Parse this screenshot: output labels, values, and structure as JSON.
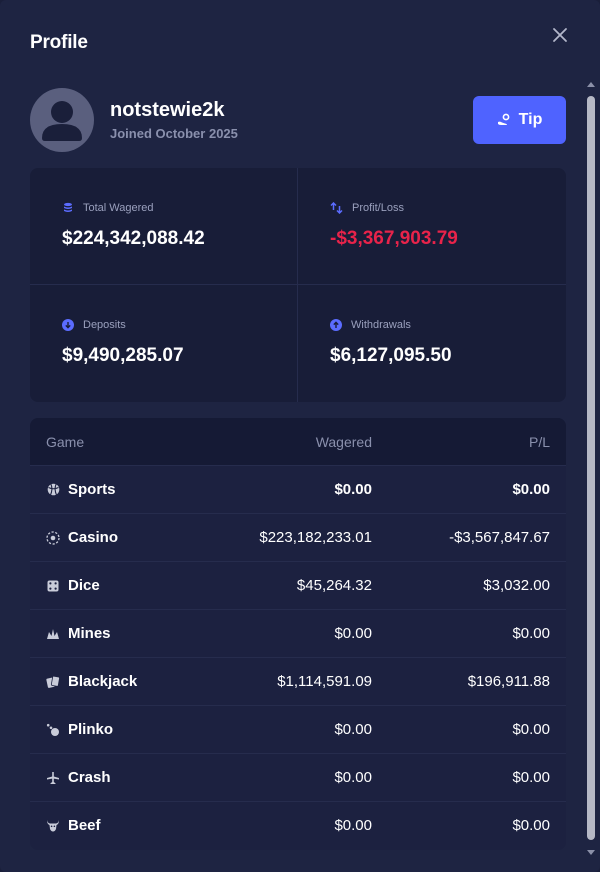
{
  "modal": {
    "title": "Profile"
  },
  "user": {
    "username": "notstewie2k",
    "joined": "Joined October 2025",
    "tip_label": "Tip"
  },
  "stats": [
    {
      "label": "Total Wagered",
      "value": "$224,342,088.42",
      "icon": "coins-icon",
      "tone": "neutral"
    },
    {
      "label": "Profit/Loss",
      "value": "-$3,367,903.79",
      "icon": "arrows-up-down-icon",
      "tone": "negative"
    },
    {
      "label": "Deposits",
      "value": "$9,490,285.07",
      "icon": "arrow-down-circle-icon",
      "tone": "neutral"
    },
    {
      "label": "Withdrawals",
      "value": "$6,127,095.50",
      "icon": "arrow-up-circle-icon",
      "tone": "neutral"
    }
  ],
  "table": {
    "headers": {
      "game": "Game",
      "wagered": "Wagered",
      "pl": "P/L"
    },
    "rows": [
      {
        "game": "Sports",
        "wagered": "$0.00",
        "pl": "$0.00",
        "icon": "sports-ball-icon",
        "pl_tone": "neutral"
      },
      {
        "game": "Casino",
        "wagered": "$223,182,233.01",
        "pl": "-$3,567,847.67",
        "icon": "casino-chip-icon",
        "pl_tone": "negative"
      },
      {
        "game": "Dice",
        "wagered": "$45,264.32",
        "pl": "$3,032.00",
        "icon": "dice-icon",
        "pl_tone": "positive"
      },
      {
        "game": "Mines",
        "wagered": "$0.00",
        "pl": "$0.00",
        "icon": "mines-icon",
        "pl_tone": "neutral"
      },
      {
        "game": "Blackjack",
        "wagered": "$1,114,591.09",
        "pl": "$196,911.88",
        "icon": "cards-icon",
        "pl_tone": "positive"
      },
      {
        "game": "Plinko",
        "wagered": "$0.00",
        "pl": "$0.00",
        "icon": "plinko-icon",
        "pl_tone": "neutral"
      },
      {
        "game": "Crash",
        "wagered": "$0.00",
        "pl": "$0.00",
        "icon": "plane-icon",
        "pl_tone": "neutral"
      },
      {
        "game": "Beef",
        "wagered": "$0.00",
        "pl": "$0.00",
        "icon": "bull-icon",
        "pl_tone": "neutral"
      }
    ]
  },
  "colors": {
    "accent": "#4f63ff",
    "negative": "#e8234a",
    "positive": "#2bd17e",
    "background": "#1e2442"
  }
}
